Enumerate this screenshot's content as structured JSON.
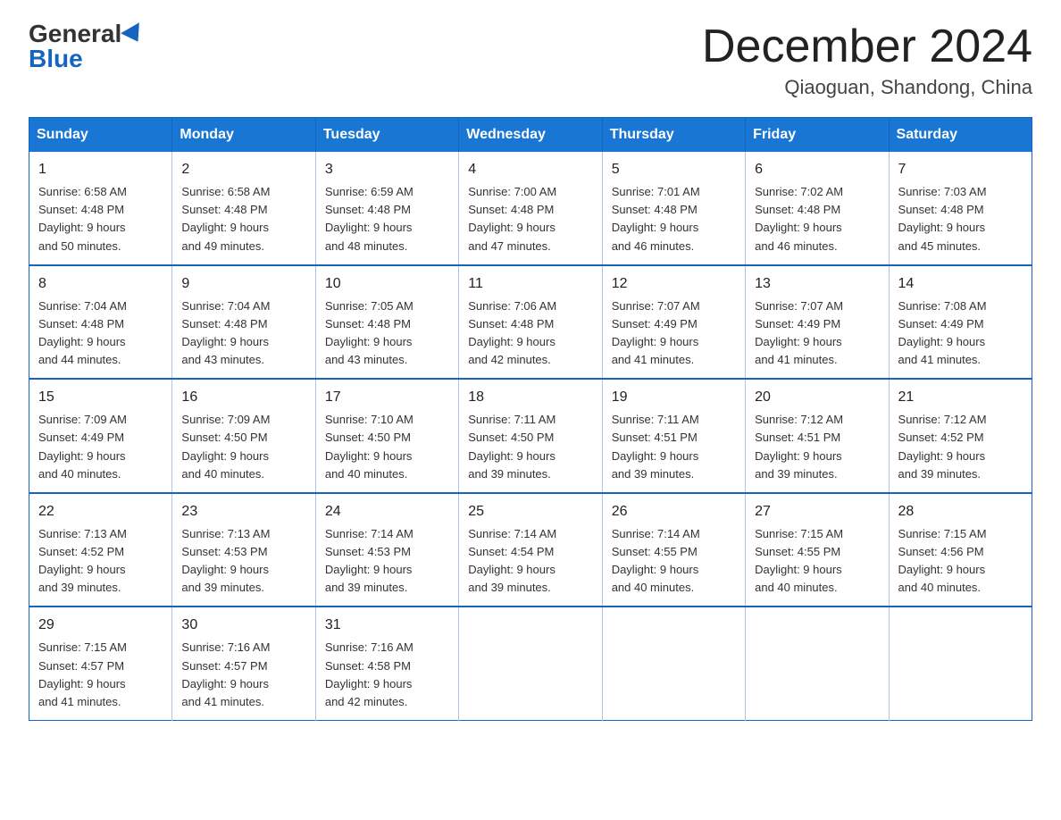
{
  "header": {
    "logo_general": "General",
    "logo_blue": "Blue",
    "month_title": "December 2024",
    "location": "Qiaoguan, Shandong, China"
  },
  "weekdays": [
    "Sunday",
    "Monday",
    "Tuesday",
    "Wednesday",
    "Thursday",
    "Friday",
    "Saturday"
  ],
  "weeks": [
    [
      {
        "day": "1",
        "sunrise": "6:58 AM",
        "sunset": "4:48 PM",
        "daylight": "9 hours and 50 minutes."
      },
      {
        "day": "2",
        "sunrise": "6:58 AM",
        "sunset": "4:48 PM",
        "daylight": "9 hours and 49 minutes."
      },
      {
        "day": "3",
        "sunrise": "6:59 AM",
        "sunset": "4:48 PM",
        "daylight": "9 hours and 48 minutes."
      },
      {
        "day": "4",
        "sunrise": "7:00 AM",
        "sunset": "4:48 PM",
        "daylight": "9 hours and 47 minutes."
      },
      {
        "day": "5",
        "sunrise": "7:01 AM",
        "sunset": "4:48 PM",
        "daylight": "9 hours and 46 minutes."
      },
      {
        "day": "6",
        "sunrise": "7:02 AM",
        "sunset": "4:48 PM",
        "daylight": "9 hours and 46 minutes."
      },
      {
        "day": "7",
        "sunrise": "7:03 AM",
        "sunset": "4:48 PM",
        "daylight": "9 hours and 45 minutes."
      }
    ],
    [
      {
        "day": "8",
        "sunrise": "7:04 AM",
        "sunset": "4:48 PM",
        "daylight": "9 hours and 44 minutes."
      },
      {
        "day": "9",
        "sunrise": "7:04 AM",
        "sunset": "4:48 PM",
        "daylight": "9 hours and 43 minutes."
      },
      {
        "day": "10",
        "sunrise": "7:05 AM",
        "sunset": "4:48 PM",
        "daylight": "9 hours and 43 minutes."
      },
      {
        "day": "11",
        "sunrise": "7:06 AM",
        "sunset": "4:48 PM",
        "daylight": "9 hours and 42 minutes."
      },
      {
        "day": "12",
        "sunrise": "7:07 AM",
        "sunset": "4:49 PM",
        "daylight": "9 hours and 41 minutes."
      },
      {
        "day": "13",
        "sunrise": "7:07 AM",
        "sunset": "4:49 PM",
        "daylight": "9 hours and 41 minutes."
      },
      {
        "day": "14",
        "sunrise": "7:08 AM",
        "sunset": "4:49 PM",
        "daylight": "9 hours and 41 minutes."
      }
    ],
    [
      {
        "day": "15",
        "sunrise": "7:09 AM",
        "sunset": "4:49 PM",
        "daylight": "9 hours and 40 minutes."
      },
      {
        "day": "16",
        "sunrise": "7:09 AM",
        "sunset": "4:50 PM",
        "daylight": "9 hours and 40 minutes."
      },
      {
        "day": "17",
        "sunrise": "7:10 AM",
        "sunset": "4:50 PM",
        "daylight": "9 hours and 40 minutes."
      },
      {
        "day": "18",
        "sunrise": "7:11 AM",
        "sunset": "4:50 PM",
        "daylight": "9 hours and 39 minutes."
      },
      {
        "day": "19",
        "sunrise": "7:11 AM",
        "sunset": "4:51 PM",
        "daylight": "9 hours and 39 minutes."
      },
      {
        "day": "20",
        "sunrise": "7:12 AM",
        "sunset": "4:51 PM",
        "daylight": "9 hours and 39 minutes."
      },
      {
        "day": "21",
        "sunrise": "7:12 AM",
        "sunset": "4:52 PM",
        "daylight": "9 hours and 39 minutes."
      }
    ],
    [
      {
        "day": "22",
        "sunrise": "7:13 AM",
        "sunset": "4:52 PM",
        "daylight": "9 hours and 39 minutes."
      },
      {
        "day": "23",
        "sunrise": "7:13 AM",
        "sunset": "4:53 PM",
        "daylight": "9 hours and 39 minutes."
      },
      {
        "day": "24",
        "sunrise": "7:14 AM",
        "sunset": "4:53 PM",
        "daylight": "9 hours and 39 minutes."
      },
      {
        "day": "25",
        "sunrise": "7:14 AM",
        "sunset": "4:54 PM",
        "daylight": "9 hours and 39 minutes."
      },
      {
        "day": "26",
        "sunrise": "7:14 AM",
        "sunset": "4:55 PM",
        "daylight": "9 hours and 40 minutes."
      },
      {
        "day": "27",
        "sunrise": "7:15 AM",
        "sunset": "4:55 PM",
        "daylight": "9 hours and 40 minutes."
      },
      {
        "day": "28",
        "sunrise": "7:15 AM",
        "sunset": "4:56 PM",
        "daylight": "9 hours and 40 minutes."
      }
    ],
    [
      {
        "day": "29",
        "sunrise": "7:15 AM",
        "sunset": "4:57 PM",
        "daylight": "9 hours and 41 minutes."
      },
      {
        "day": "30",
        "sunrise": "7:16 AM",
        "sunset": "4:57 PM",
        "daylight": "9 hours and 41 minutes."
      },
      {
        "day": "31",
        "sunrise": "7:16 AM",
        "sunset": "4:58 PM",
        "daylight": "9 hours and 42 minutes."
      },
      null,
      null,
      null,
      null
    ]
  ],
  "labels": {
    "sunrise": "Sunrise:",
    "sunset": "Sunset:",
    "daylight": "Daylight:"
  }
}
